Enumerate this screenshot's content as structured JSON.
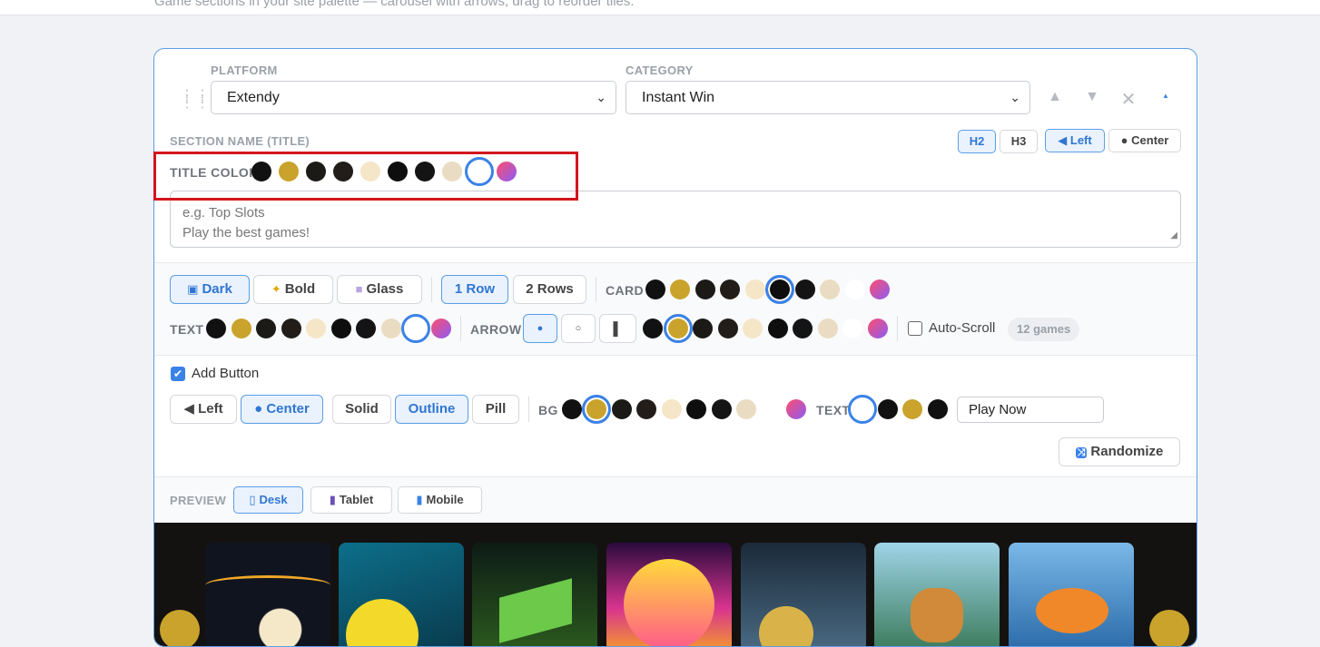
{
  "top_hint": "Game sections in your site palette — carousel with arrows, drag to reorder tiles.",
  "platform": {
    "label": "PLATFORM",
    "value": "Extendy"
  },
  "category": {
    "label": "CATEGORY",
    "value": "Instant Win"
  },
  "section_name_label": "SECTION NAME (TITLE)",
  "heading_buttons": [
    "H2",
    "H3",
    "◀ Left",
    "● Center"
  ],
  "title_color_label": "TITLE COLOR",
  "palette": [
    "#111111",
    "#c9a32c",
    "#1c1a17",
    "#221d18",
    "#f5e6c8",
    "#0e0e0e",
    "#141414",
    "#eadcc2",
    "#ffffff",
    "gradient"
  ],
  "textarea": {
    "placeholder_line1": "e.g. Top Slots",
    "placeholder_line2": "Play the best games!"
  },
  "style_buttons": {
    "dark": "Dark",
    "bold": "Bold",
    "glass": "Glass"
  },
  "row_buttons": {
    "one": "1 Row",
    "two": "2 Rows"
  },
  "card_label": "CARD",
  "text_label": "TEXT",
  "arrow_label": "ARROW",
  "arrow_buttons": [
    "●",
    "○",
    "▌"
  ],
  "auto_scroll_label": "Auto-Scroll",
  "games_badge": "12 games",
  "add_button_label": "Add Button",
  "align_buttons": {
    "left": "◀ Left",
    "center": "● Center"
  },
  "variant_buttons": {
    "solid": "Solid",
    "outline": "Outline",
    "pill": "Pill"
  },
  "bg_label": "BG",
  "button_text_label": "TEXT",
  "button_text_value": "Play Now",
  "randomize_label": "Randomize",
  "preview_label": "PREVIEW",
  "preview_buttons": {
    "desk": "Desk",
    "tablet": "Tablet",
    "mobile": "Mobile"
  },
  "colors": {
    "accent": "#3a82e8",
    "highlight": "#d2161e",
    "gold": "#c9a32c"
  }
}
